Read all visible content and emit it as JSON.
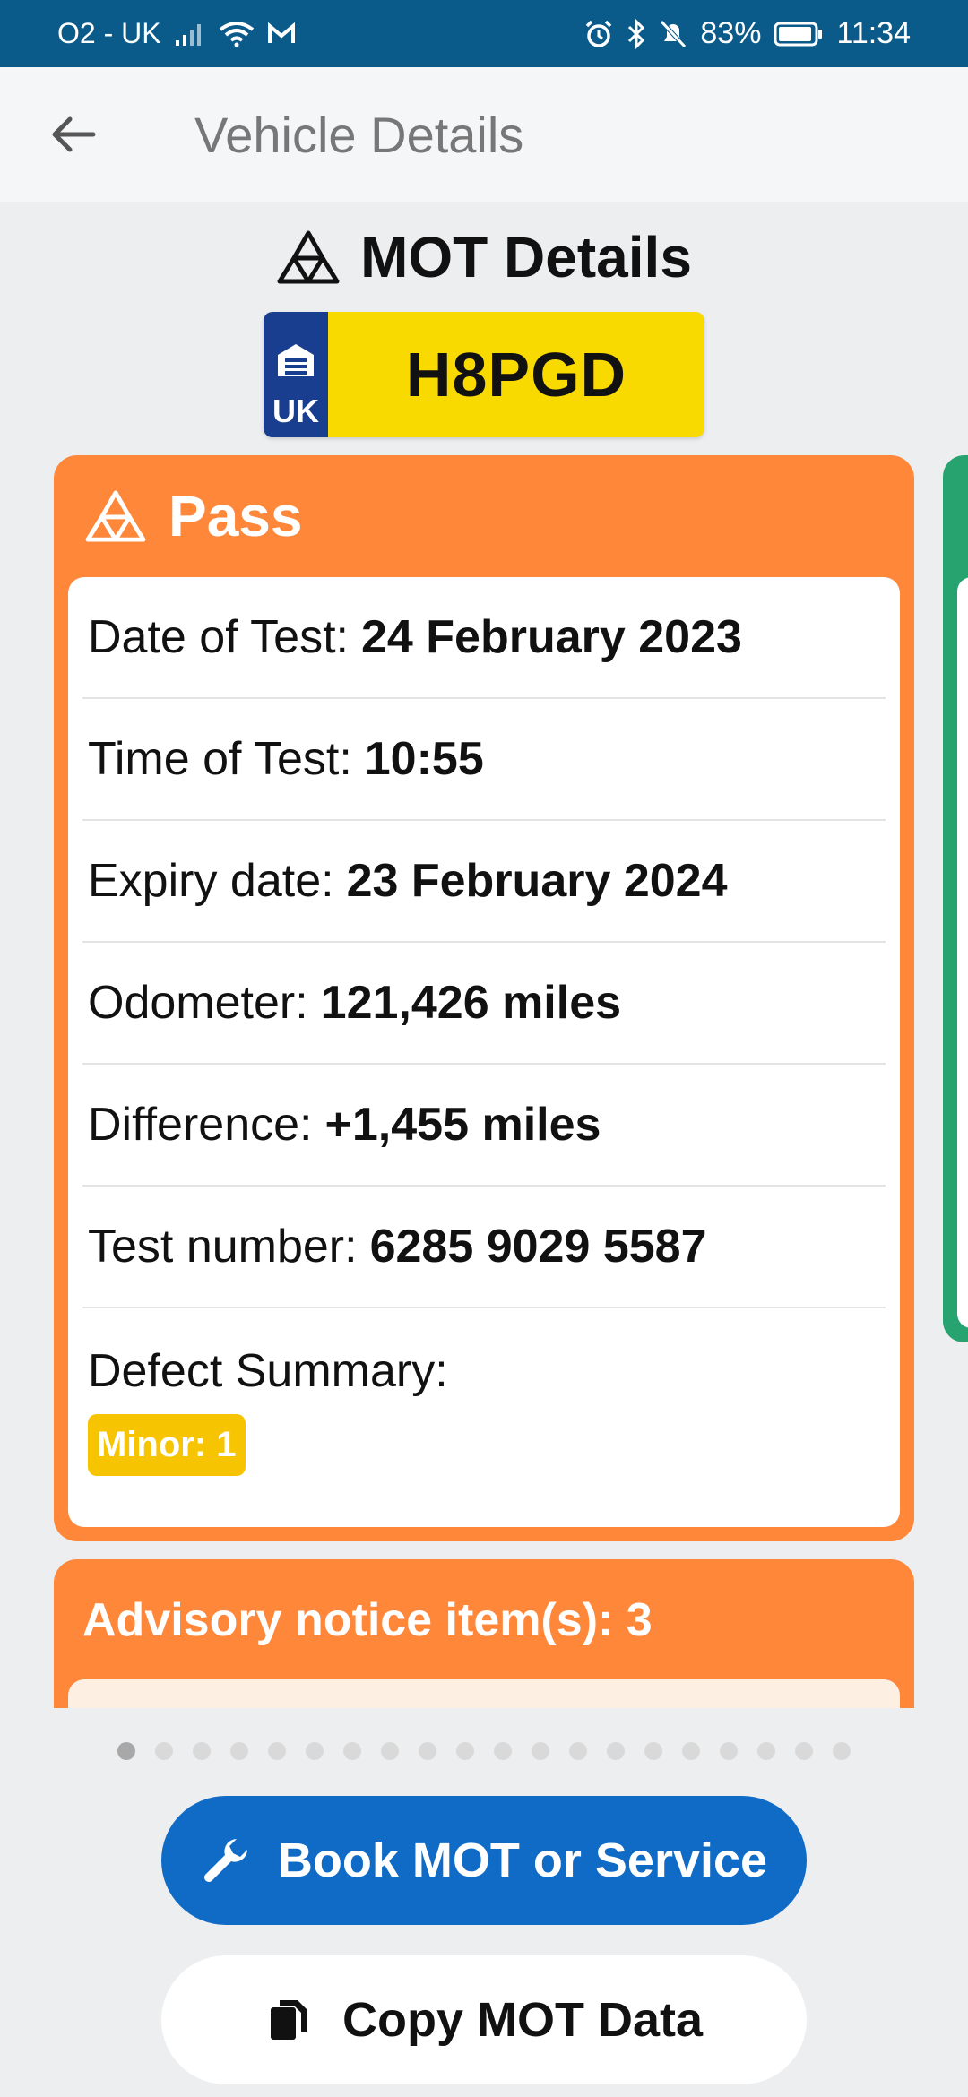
{
  "status_bar": {
    "carrier": "O2 - UK",
    "battery": "83%",
    "time": "11:34",
    "icons": [
      "signal-icon",
      "wifi-icon",
      "mail-icon",
      "alarm-icon",
      "bluetooth-icon",
      "mute-icon",
      "battery-icon"
    ]
  },
  "app_bar": {
    "title": "Vehicle Details"
  },
  "heading": {
    "title": "MOT Details"
  },
  "plate": {
    "country": "UK",
    "registration": "H8PGD"
  },
  "result": {
    "status": "Pass",
    "color": "#ff873a",
    "rows": [
      {
        "key": "Date of Test:",
        "value": "24 February 2023"
      },
      {
        "key": "Time of Test:",
        "value": "10:55"
      },
      {
        "key": "Expiry date:",
        "value": "23 February 2024"
      },
      {
        "key": "Odometer:",
        "value": "121,426 miles"
      },
      {
        "key": "Difference:",
        "value": "+1,455 miles"
      },
      {
        "key": "Test number:",
        "value": "6285 9029 5587"
      }
    ],
    "defect_summary_label": "Defect Summary:",
    "minor_badge": "Minor: 1"
  },
  "advisory": {
    "label": "Advisory notice item(s): 3"
  },
  "pager": {
    "count": 20,
    "active_index": 0
  },
  "buttons": {
    "book": "Book MOT or Service",
    "copy": "Copy MOT Data"
  },
  "colors": {
    "status_bar": "#0b5b8a",
    "pass": "#ff873a",
    "book_button": "#0f6bc6",
    "plate_yellow": "#f9da00",
    "plate_blue": "#1a3e8f",
    "side_card": "#27a36f"
  }
}
